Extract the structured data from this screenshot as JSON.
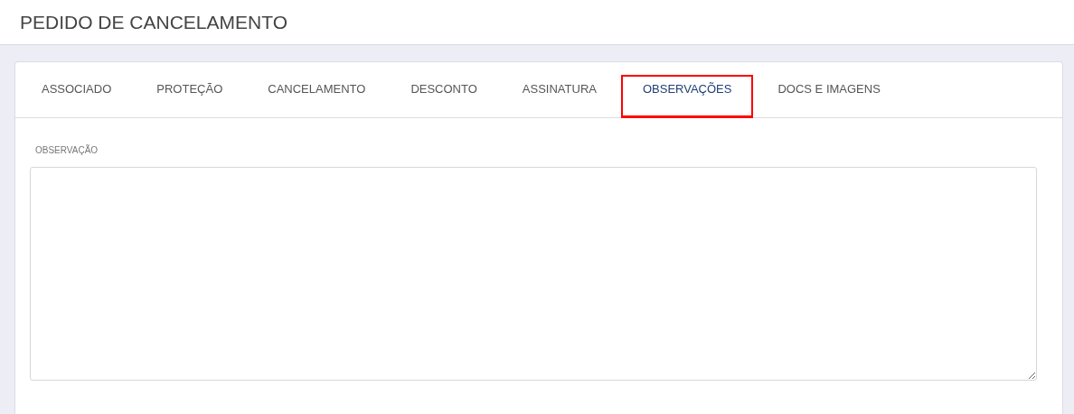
{
  "header": {
    "title": "PEDIDO DE CANCELAMENTO"
  },
  "tabs": [
    {
      "label": "ASSOCIADO",
      "selected": false
    },
    {
      "label": "PROTEÇÃO",
      "selected": false
    },
    {
      "label": "CANCELAMENTO",
      "selected": false
    },
    {
      "label": "DESCONTO",
      "selected": false
    },
    {
      "label": "ASSINATURA",
      "selected": false
    },
    {
      "label": "OBSERVAÇÕES",
      "selected": true
    },
    {
      "label": "DOCS E IMAGENS",
      "selected": false
    }
  ],
  "observation_field": {
    "label": "OBSERVAÇÃO"
  }
}
